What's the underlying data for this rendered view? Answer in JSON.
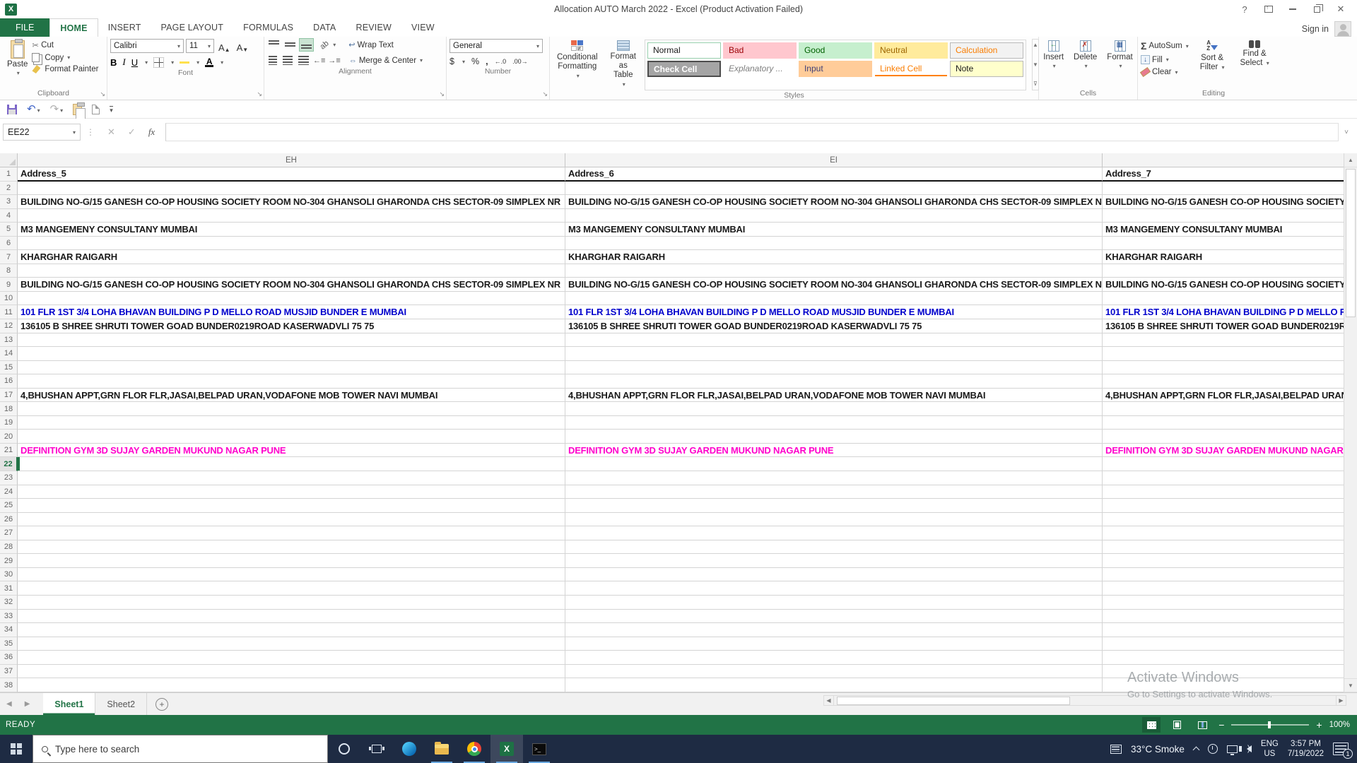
{
  "colors": {
    "excel_green": "#217346",
    "row11_blue": "#0000cc",
    "row21_magenta": "#ff00cc",
    "taskbar_bg": "#1e2b43",
    "style_bad_bg": "#ffc7ce",
    "style_good_bg": "#c6efce",
    "style_neutral_bg": "#ffeb9c",
    "style_input_bg": "#ffcc99",
    "style_note_bg": "#ffffcc"
  },
  "titlebar": {
    "title": "Allocation AUTO March 2022 - Excel (Product Activation Failed)",
    "help": "?"
  },
  "ribbon": {
    "file_tab": "FILE",
    "tabs": [
      {
        "label": "HOME",
        "active": true
      },
      {
        "label": "INSERT"
      },
      {
        "label": "PAGE LAYOUT"
      },
      {
        "label": "FORMULAS"
      },
      {
        "label": "DATA"
      },
      {
        "label": "REVIEW"
      },
      {
        "label": "VIEW"
      }
    ],
    "sign_in": "Sign in",
    "clipboard": {
      "label": "Clipboard",
      "paste": "Paste",
      "cut": "Cut",
      "copy": "Copy",
      "format_painter": "Format Painter"
    },
    "font": {
      "label": "Font",
      "name": "Calibri",
      "size": "11",
      "bold": "B",
      "italic": "I",
      "underline": "U"
    },
    "alignment": {
      "label": "Alignment",
      "wrap_text": "Wrap Text",
      "merge_center": "Merge & Center"
    },
    "number": {
      "label": "Number",
      "format": "General",
      "currency": "$",
      "percent": "%",
      "comma": ",",
      "inc_decimal": "←.0",
      "dec_decimal": ".00→"
    },
    "styles": {
      "label": "Styles",
      "conditional_line1": "Conditional",
      "conditional_line2": "Formatting",
      "format_table_line1": "Format as",
      "format_table_line2": "Table",
      "gallery": [
        [
          "Normal",
          "Bad",
          "Good",
          "Neutral",
          "Calculation"
        ],
        [
          "Check Cell",
          "Explanatory ...",
          "Input",
          "Linked Cell",
          "Note"
        ]
      ]
    },
    "cells": {
      "label": "Cells",
      "items": [
        "Insert",
        "Delete",
        "Format"
      ]
    },
    "editing": {
      "label": "Editing",
      "autosum": "AutoSum",
      "fill": "Fill",
      "clear": "Clear",
      "sort_line1": "Sort &",
      "sort_line2": "Filter",
      "find_line1": "Find &",
      "find_line2": "Select"
    }
  },
  "formula_bar": {
    "name_box": "EE22",
    "fx": "fx",
    "formula": ""
  },
  "grid": {
    "col_letters": [
      "EH",
      "EI",
      ""
    ],
    "row_count": 38,
    "selected_row": 22,
    "rows": {
      "1": {
        "style": "colheader",
        "cells": [
          "Address_5",
          "Address_6",
          "Address_7"
        ]
      },
      "3": {
        "style": "addr",
        "text": "BUILDING NO-G/15 GANESH CO-OP HOUSING SOCIETY ROOM NO-304 GHANSOLI GHARONDA CHS SECTOR-09 SIMPLEX NR"
      },
      "5": {
        "style": "addr",
        "text": "M3 MANGEMENY  CONSULTANY MUMBAI"
      },
      "7": {
        "style": "addr",
        "text": "KHARGHAR RAIGARH"
      },
      "9": {
        "style": "addr",
        "text": "BUILDING NO-G/15 GANESH CO-OP HOUSING SOCIETY ROOM NO-304 GHANSOLI GHARONDA CHS SECTOR-09 SIMPLEX NR"
      },
      "11": {
        "style": "blue",
        "text": "101 FLR 1ST 3/4 LOHA BHAVAN BUILDING P D MELLO ROAD MUSJID BUNDER E MUMBAI"
      },
      "12": {
        "style": "addr",
        "text": "136105 B SHREE SHRUTI TOWER GOAD BUNDER0219ROAD KASERWADVLI 75 75"
      },
      "17": {
        "style": "addr",
        "text": "4,BHUSHAN APPT,GRN FLOR FLR,JASAI,BELPAD URAN,VODAFONE MOB TOWER NAVI MUMBAI"
      },
      "21": {
        "style": "magenta",
        "text": "DEFINITION GYM 3D SUJAY GARDEN MUKUND NAGAR PUNE"
      }
    }
  },
  "sheet_tabs": {
    "tabs": [
      {
        "label": "Sheet1",
        "active": true
      },
      {
        "label": "Sheet2"
      }
    ]
  },
  "status_bar": {
    "mode": "READY",
    "zoom": "100%"
  },
  "watermark": {
    "line1": "Activate Windows",
    "line2": "Go to Settings to activate Windows."
  },
  "taskbar": {
    "search_placeholder": "Type here to search",
    "weather": "33°C Smoke",
    "lang_top": "ENG",
    "lang_bottom": "US",
    "time": "3:57 PM",
    "date": "7/19/2022",
    "badge": "1"
  }
}
